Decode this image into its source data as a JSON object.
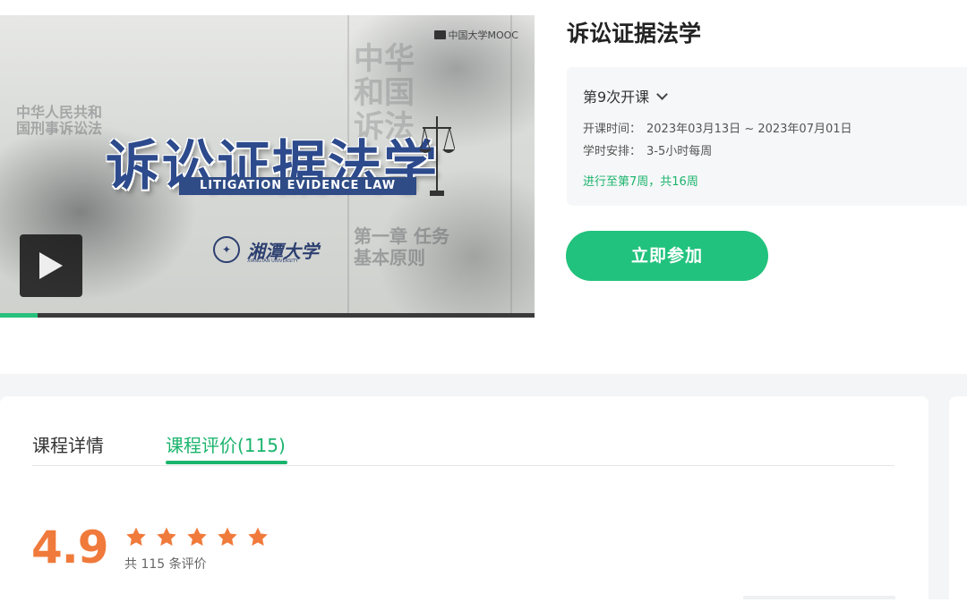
{
  "video": {
    "brand": "中国大学MOOC",
    "title_cn": "诉讼证据法学",
    "title_en": "LITIGATION EVIDENCE LAW",
    "university_name": "湘潭大学",
    "university_en": "XIANGTAN UNIVERSITY",
    "progress_fraction": 0.07
  },
  "course": {
    "title": "诉讼证据法学",
    "term_label": "第9次开课",
    "schedule": {
      "date_label": "开课时间：",
      "date_value": "2023年03月13日 ~ 2023年07月01日",
      "hours_label": "学时安排：",
      "hours_value": "3-5小时每周"
    },
    "progress_text": "进行至第7周，共16周",
    "join_button": "立即参加"
  },
  "tabs": [
    {
      "label": "课程详情",
      "active": false
    },
    {
      "label": "课程评价(115)",
      "active": true
    }
  ],
  "rating": {
    "score": "4.9",
    "stars": 5,
    "count_text": "共 115 条评价"
  },
  "colors": {
    "accent_green": "#21c27d",
    "score_orange": "#f07a3b",
    "title_blue": "#2c4a8c"
  }
}
